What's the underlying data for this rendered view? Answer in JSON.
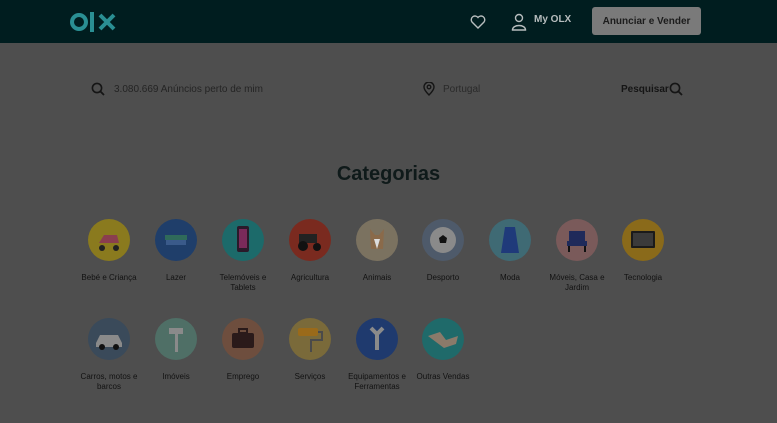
{
  "header": {
    "logo_text": "olx",
    "my_olx": "My OLX",
    "sell_button": "Anunciar e Vender",
    "icons": [
      "heart-icon",
      "user-icon"
    ]
  },
  "search": {
    "query_placeholder": "3.080.669 Anúncios perto de mim",
    "location_placeholder": "Portugal",
    "submit_label": "Pesquisar"
  },
  "categories": {
    "title": "Categorias",
    "items": [
      {
        "label": "Bebé e Criança",
        "color": "#8a7a1e"
      },
      {
        "label": "Lazer",
        "color": "#1f3e6a"
      },
      {
        "label": "Telemóveis e Tablets",
        "color": "#1c6a6a"
      },
      {
        "label": "Agricultura",
        "color": "#7a2a1f"
      },
      {
        "label": "Animais",
        "color": "#7b7260"
      },
      {
        "label": "Desporto",
        "color": "#4e5a6a"
      },
      {
        "label": "Moda",
        "color": "#3f6a74"
      },
      {
        "label": "Móveis, Casa e Jardim",
        "color": "#7a5a5a"
      },
      {
        "label": "Tecnologia",
        "color": "#8a6a1a"
      },
      {
        "label": "Carros, motos e barcos",
        "color": "#3a4a5a"
      },
      {
        "label": "Imóveis",
        "color": "#4f6f66"
      },
      {
        "label": "Emprego",
        "color": "#6e4e3e"
      },
      {
        "label": "Serviços",
        "color": "#7a6a3a"
      },
      {
        "label": "Equipamentos e Ferramentas",
        "color": "#1f3a6e"
      },
      {
        "label": "Outras Vendas",
        "color": "#1f6a6a"
      }
    ]
  }
}
